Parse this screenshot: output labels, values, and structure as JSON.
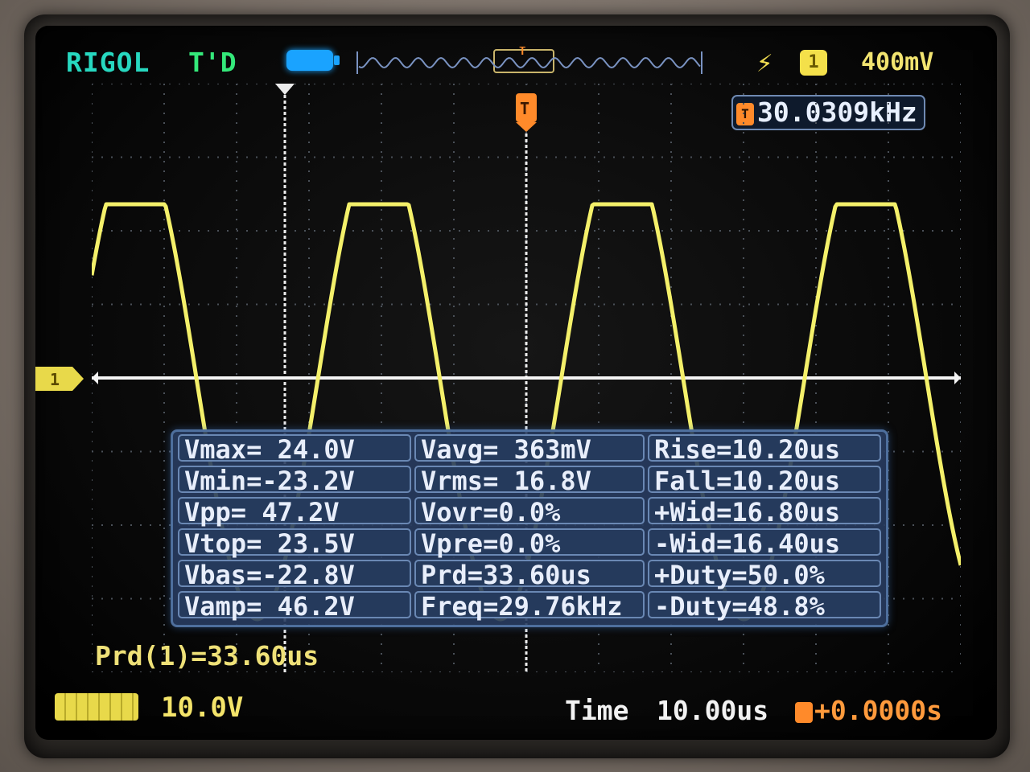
{
  "status_bar": {
    "brand": "RIGOL",
    "trigger_status": "T'D",
    "trigger_source_channel": "1",
    "trigger_level": "400mV"
  },
  "counter": {
    "icon_label": "T",
    "frequency": "30.0309kHz"
  },
  "channel_marker": "1",
  "measurements": {
    "col1": [
      "Vmax= 24.0V",
      "Vmin=-23.2V",
      "Vpp= 47.2V",
      "Vtop= 23.5V",
      "Vbas=-22.8V",
      "Vamp= 46.2V"
    ],
    "col2": [
      "Vavg= 363mV",
      "Vrms= 16.8V",
      "Vovr=0.0%",
      "Vpre=0.0%",
      "Prd=33.60us",
      "Freq=29.76kHz"
    ],
    "col3": [
      "Rise=10.20us",
      "Fall=10.20us",
      "+Wid=16.80us",
      "-Wid=16.40us",
      "+Duty=50.0%",
      "-Duty=48.8%"
    ]
  },
  "period_readout": "Prd(1)=33.60us",
  "bottom_bar": {
    "channel_scale": "10.0V",
    "time_label": "Time",
    "time_base": "10.00us",
    "trigger_delay": "+0.0000s"
  },
  "colors": {
    "trace": "#f4f06a",
    "grid": "#4a5058",
    "cursor": "#f2f2f2",
    "trigger_marker": "#ff8a2a",
    "panel": "#283c60"
  }
}
